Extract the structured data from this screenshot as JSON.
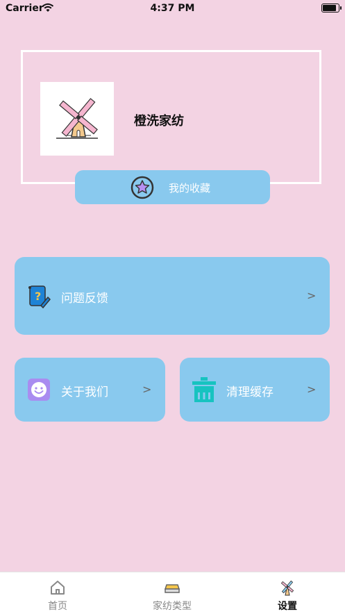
{
  "status_bar": {
    "carrier": "Carrier",
    "time": "4:37 PM"
  },
  "profile": {
    "brand_name": "橙洗家纺",
    "logo_icon": "windmill-icon"
  },
  "favorites_button": {
    "label": "我的收藏",
    "icon": "star-icon"
  },
  "menu": {
    "feedback": {
      "label": "问题反馈",
      "icon": "question-notebook-icon"
    },
    "about": {
      "label": "关于我们",
      "icon": "smile-icon"
    },
    "clear_cache": {
      "label": "清理缓存",
      "icon": "trash-icon"
    },
    "chevron": ">"
  },
  "tab_bar": {
    "tabs": [
      {
        "label": "首页",
        "icon": "home-icon"
      },
      {
        "label": "家纺类型",
        "icon": "bedding-icon"
      },
      {
        "label": "设置",
        "icon": "windmill-icon",
        "active": true
      }
    ]
  },
  "colors": {
    "background": "#f3d3e3",
    "card": "#89c9ee",
    "accent_purple": "#a98cf0",
    "accent_teal": "#17c3c0"
  }
}
